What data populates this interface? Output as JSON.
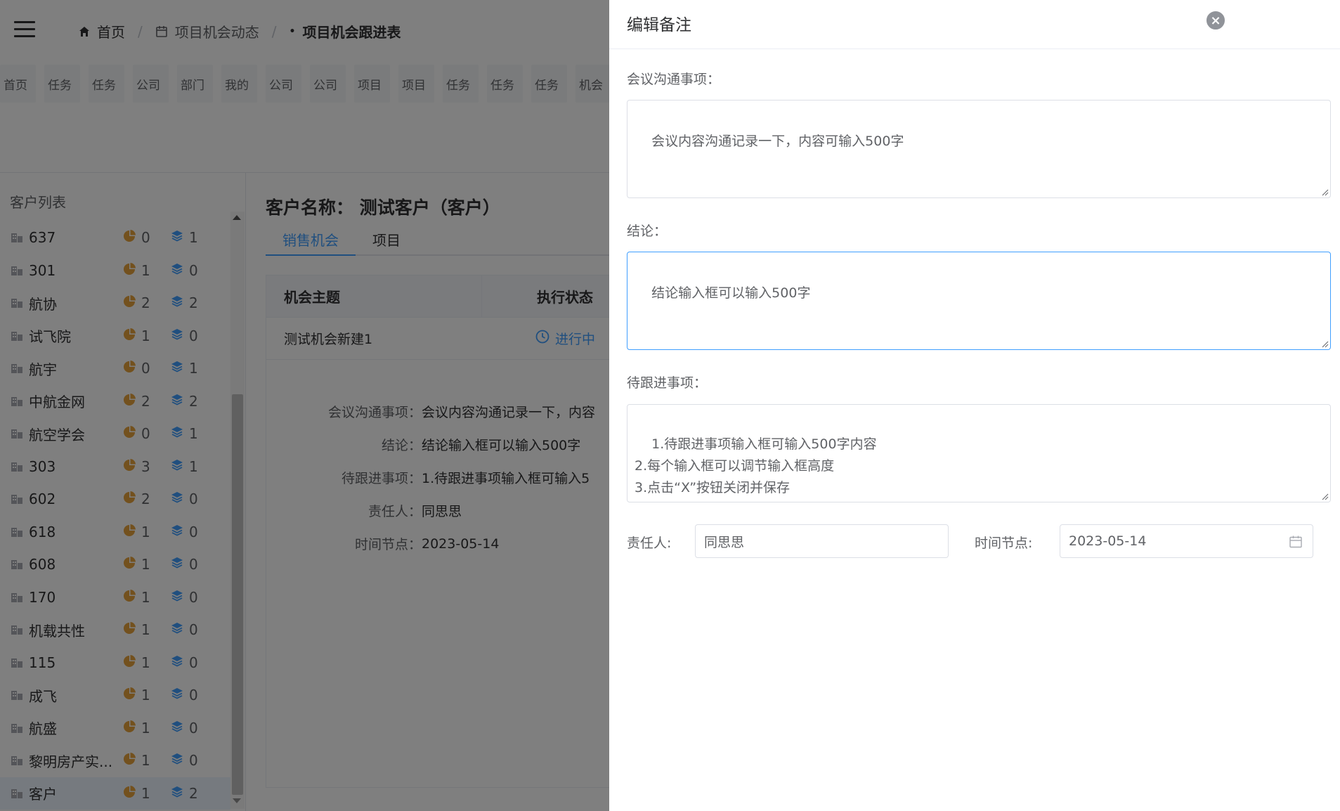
{
  "breadcrumb": {
    "home": "首页",
    "section": "项目机会动态",
    "current": "项目机会跟进表",
    "separator": "/"
  },
  "tabs": [
    "首页",
    "任务",
    "任务",
    "公司",
    "部门",
    "我的",
    "公司",
    "公司",
    "项目",
    "项目",
    "任务",
    "任务",
    "任务",
    "机会"
  ],
  "sidebar": {
    "title": "客户列表",
    "customers": [
      {
        "name": "637",
        "opp": "0",
        "proj": "1"
      },
      {
        "name": "301",
        "opp": "1",
        "proj": "0"
      },
      {
        "name": "航协",
        "opp": "2",
        "proj": "2"
      },
      {
        "name": "试飞院",
        "opp": "1",
        "proj": "0"
      },
      {
        "name": "航宇",
        "opp": "0",
        "proj": "1"
      },
      {
        "name": "中航金网",
        "opp": "2",
        "proj": "2"
      },
      {
        "name": "航空学会",
        "opp": "0",
        "proj": "1"
      },
      {
        "name": "303",
        "opp": "3",
        "proj": "1"
      },
      {
        "name": "602",
        "opp": "2",
        "proj": "0"
      },
      {
        "name": "618",
        "opp": "1",
        "proj": "0"
      },
      {
        "name": "608",
        "opp": "1",
        "proj": "0"
      },
      {
        "name": "170",
        "opp": "1",
        "proj": "0"
      },
      {
        "name": "机载共性",
        "opp": "1",
        "proj": "0"
      },
      {
        "name": "115",
        "opp": "1",
        "proj": "0"
      },
      {
        "name": "成飞",
        "opp": "1",
        "proj": "0"
      },
      {
        "name": "航盛",
        "opp": "1",
        "proj": "0"
      },
      {
        "name": "黎明房产实...",
        "opp": "1",
        "proj": "0"
      },
      {
        "name": "客户",
        "opp": "1",
        "proj": "2"
      }
    ]
  },
  "main": {
    "customer_title": "客户名称：  测试客户（客户）",
    "subtabs": [
      "销售机会",
      "项目"
    ],
    "table": {
      "col_topic": "机会主题",
      "col_status": "执行状态",
      "row_topic": "测试机会新建1",
      "row_status": "进行中"
    },
    "detail": [
      {
        "label": "会议沟通事项：",
        "value": "会议内容沟通记录一下，内容"
      },
      {
        "label": "结论：",
        "value": "结论输入框可以输入500字"
      },
      {
        "label": "待跟进事项：",
        "value": "1.待跟进事项输入框可输入5"
      },
      {
        "label": "责任人：",
        "value": "同思思"
      },
      {
        "label": "时间节点：",
        "value": "2023-05-14"
      }
    ]
  },
  "drawer": {
    "title": "编辑备注",
    "close_glyph": "×",
    "meeting_label": "会议沟通事项：",
    "meeting_value": "会议内容沟通记录一下，内容可输入500字",
    "conclusion_label": "结论：",
    "conclusion_value": "结论输入框可以输入500字",
    "followup_label": "待跟进事项：",
    "followup_value": "1.待跟进事项输入框可输入500字内容\n2.每个输入框可以调节输入框高度\n3.点击“X”按钮关闭并保存",
    "owner_label": "责任人:",
    "owner_value": "同思思",
    "date_label": "时间节点:",
    "date_value": "2023-05-14"
  },
  "colors": {
    "accent": "#409eff",
    "opp_icon": "#e6a23c",
    "proj_icon": "#409eff",
    "mask": "rgba(0,0,0,0.5)"
  }
}
